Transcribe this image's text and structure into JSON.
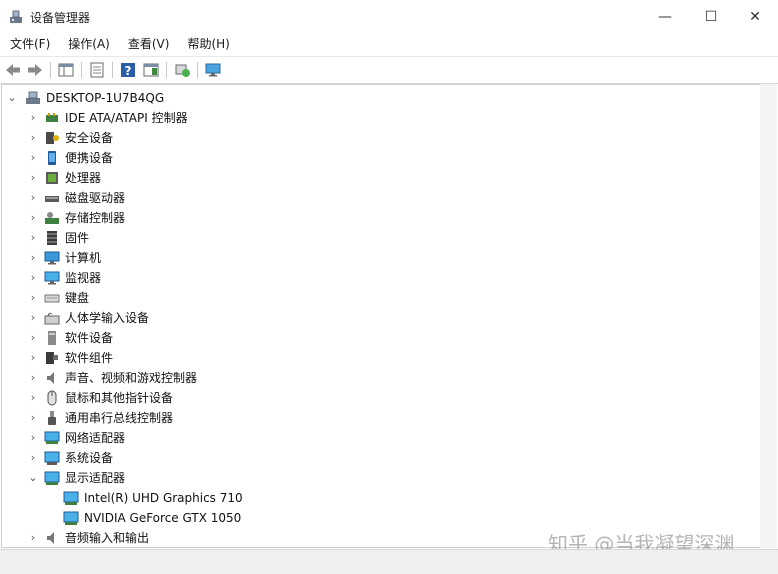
{
  "window": {
    "title": "设备管理器",
    "controls": {
      "minimize": "—",
      "maximize": "☐",
      "close": "✕"
    }
  },
  "menu": [
    "文件(F)",
    "操作(A)",
    "查看(V)",
    "帮助(H)"
  ],
  "tree": {
    "root": "DESKTOP-1U7B4QG",
    "items": [
      {
        "label": "IDE ATA/ATAPI 控制器",
        "icon": "ide-controller-icon"
      },
      {
        "label": "安全设备",
        "icon": "security-device-icon"
      },
      {
        "label": "便携设备",
        "icon": "portable-device-icon"
      },
      {
        "label": "处理器",
        "icon": "processor-icon"
      },
      {
        "label": "磁盘驱动器",
        "icon": "disk-drive-icon"
      },
      {
        "label": "存储控制器",
        "icon": "storage-controller-icon"
      },
      {
        "label": "固件",
        "icon": "firmware-icon"
      },
      {
        "label": "计算机",
        "icon": "computer-icon"
      },
      {
        "label": "监视器",
        "icon": "monitor-icon"
      },
      {
        "label": "键盘",
        "icon": "keyboard-icon"
      },
      {
        "label": "人体学输入设备",
        "icon": "hid-icon"
      },
      {
        "label": "软件设备",
        "icon": "software-device-icon"
      },
      {
        "label": "软件组件",
        "icon": "software-component-icon"
      },
      {
        "label": "声音、视频和游戏控制器",
        "icon": "sound-icon"
      },
      {
        "label": "鼠标和其他指针设备",
        "icon": "mouse-icon"
      },
      {
        "label": "通用串行总线控制器",
        "icon": "usb-icon"
      },
      {
        "label": "网络适配器",
        "icon": "network-adapter-icon"
      },
      {
        "label": "系统设备",
        "icon": "system-device-icon"
      },
      {
        "label": "显示适配器",
        "icon": "display-adapter-icon",
        "expanded": true,
        "children": [
          "Intel(R) UHD Graphics 710",
          "NVIDIA GeForce GTX 1050"
        ]
      },
      {
        "label": "音频输入和输出",
        "icon": "audio-io-icon"
      }
    ]
  },
  "watermark": "知乎 @当我凝望深渊"
}
